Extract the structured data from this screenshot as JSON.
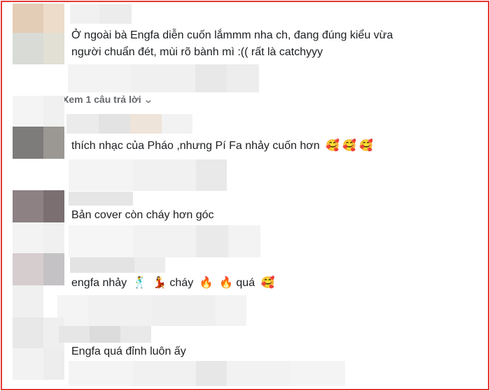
{
  "comments": [
    {
      "text": "Ở ngoài bà Engfa diễn cuốn lắmmm nha ch, đang đúng kiểu vừa"
    },
    {
      "text": "người chuẩn đét, mùi rõ bành mì :(( rất là catchyyy"
    },
    {
      "text": "thích nhạc của Pháo ,nhưng Pí Fa nhảy cuốn hơn",
      "emojis": [
        "🥰",
        "🥰",
        "🥰"
      ]
    },
    {
      "text": "Bản cover còn cháy hơn góc"
    },
    {
      "parts": [
        "engfa nhảy",
        "🕺",
        "💃",
        "cháy",
        "🔥",
        "🔥",
        "quá",
        "🥰"
      ]
    },
    {
      "text": "Engfa quá đỉnh luôn ấy"
    }
  ],
  "reply_link": {
    "label": "Xem 1 câu trả lời",
    "icon": "chevron-down-icon"
  },
  "colors": {
    "border": "#e53935",
    "text": "#1c1e21",
    "muted": "#65676b"
  }
}
